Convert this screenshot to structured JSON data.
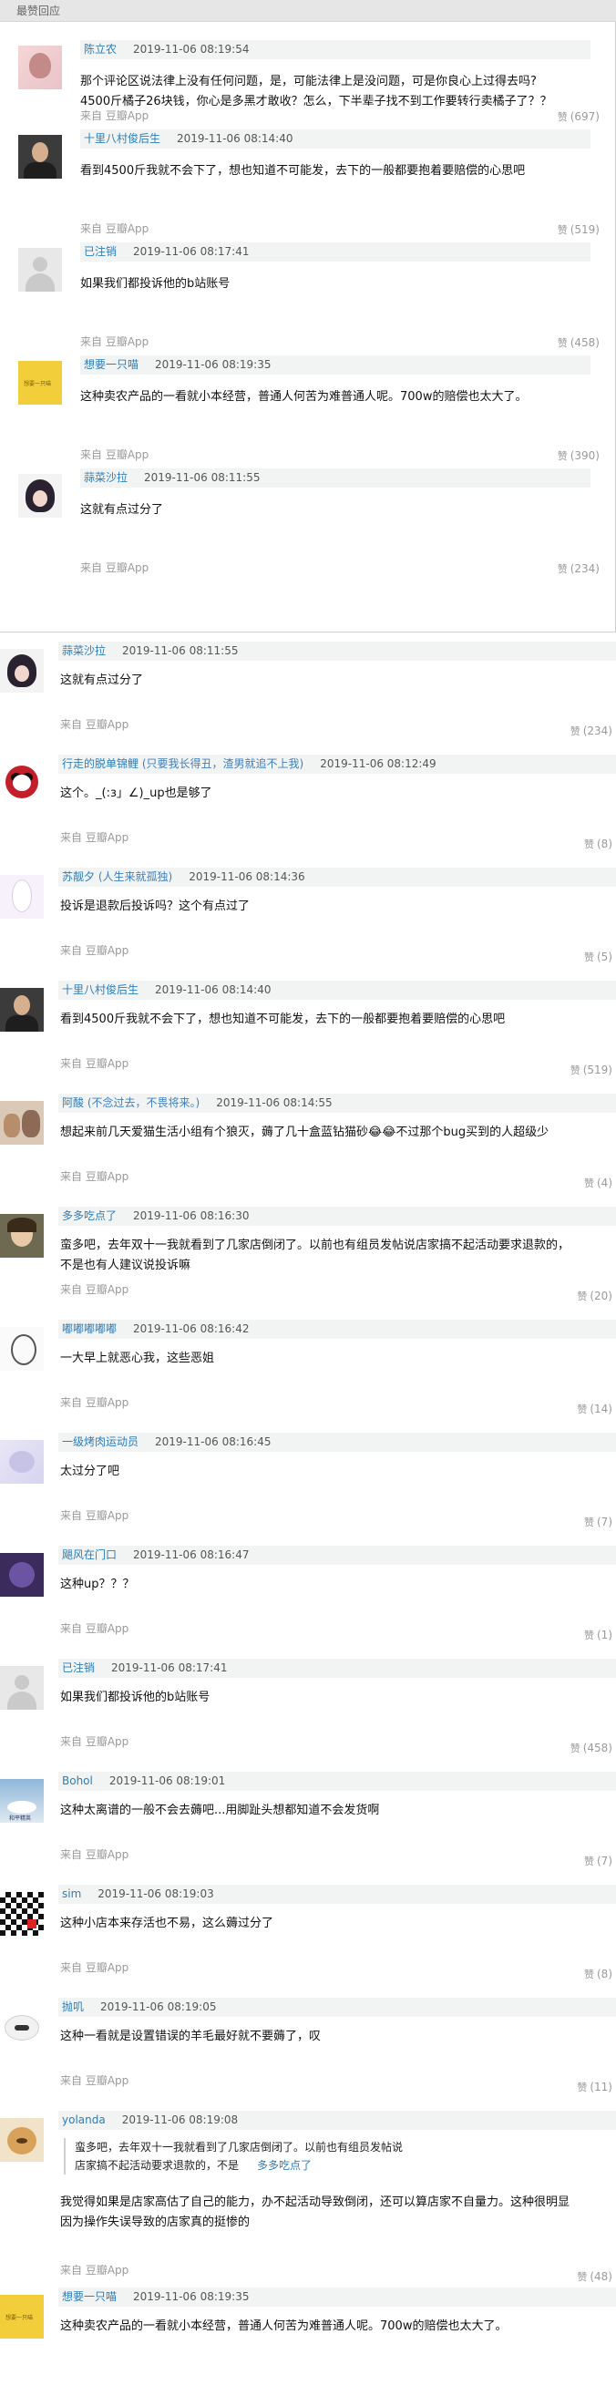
{
  "header": {
    "title": "最赞回应"
  },
  "hot_comments": [
    {
      "author": "陈立农",
      "time": "2019-11-06 08:19:54",
      "text": "那个评论区说法律上没有任何问题，是，可能法律上是没问题，可是你良心上过得去吗?\n4500斤橘子26块钱，你心是多黑才敢收？怎么，下半辈子找不到工作要转行卖橘子了？？",
      "source": "",
      "likes": "",
      "avatar": "pink"
    },
    {
      "author": "十里八村俊后生",
      "time": "2019-11-06 08:14:40",
      "text": "看到4500斤我就不会下了，想也知道不可能发，去下的一般都要抱着要赔偿的心思吧",
      "source": "来自 豆瓣App",
      "likes": "(697)",
      "avatar": "man"
    },
    {
      "author": "已注销",
      "time": "2019-11-06 08:17:41",
      "text": "如果我们都投诉他的b站账号",
      "source": "来自 豆瓣App",
      "likes": "(519)",
      "avatar": "grey"
    },
    {
      "author": "想要一只喵",
      "time": "2019-11-06 08:19:35",
      "text": "这种卖农产品的一看就小本经营，普通人何苦为难普通人呢。700w的赔偿也太大了。",
      "source": "来自 豆瓣App",
      "likes": "(458)",
      "avatar": "yellow"
    },
    {
      "author": "蒜菜沙拉",
      "time": "2019-11-06 08:11:55",
      "text": "这就有点过分了",
      "source": "来自 豆瓣App",
      "likes": "(390)",
      "avatar": "anime"
    },
    {
      "author": "",
      "time": "",
      "text": "",
      "source": "来自 豆瓣App",
      "likes": "(234)",
      "avatar": ""
    }
  ],
  "thread_comments": [
    {
      "author": "蒜菜沙拉",
      "extra": "",
      "time": "2019-11-06 08:11:55",
      "text": "这就有点过分了",
      "likes": "(234)",
      "avatar": "anime"
    },
    {
      "author": "行走的脱单锦鲤",
      "extra": "(只要我长得丑，渣男就追不上我)",
      "time": "2019-11-06 08:12:49",
      "text": "这个。_(:з」∠)_up也是够了",
      "likes": "(8)",
      "avatar": "panda"
    },
    {
      "author": "苏靓夕",
      "extra": "(人生来就孤独)",
      "time": "2019-11-06 08:14:36",
      "text": "投诉是退款后投诉吗？这个有点过了",
      "likes": "(5)",
      "avatar": "rabbit"
    },
    {
      "author": "十里八村俊后生",
      "extra": "",
      "time": "2019-11-06 08:14:40",
      "text": "看到4500斤我就不会下了，想也知道不可能发，去下的一般都要抱着要赔偿的心思吧",
      "likes": "(519)",
      "avatar": "man"
    },
    {
      "author": "阿酸",
      "extra": "(不念过去，不畏将来。)",
      "time": "2019-11-06 08:14:55",
      "text": "想起来前几天爱猫生活小组有个狼灭，薅了几十盒蓝钻猫砂😂😂不过那个bug买到的人超级少",
      "likes": "(4)",
      "avatar": "people"
    },
    {
      "author": "多多吃点了",
      "extra": "",
      "time": "2019-11-06 08:16:30",
      "text": "蛮多吧，去年双十一我就看到了几家店倒闭了。以前也有组员发帖说店家搞不起活动要求退款的，\n不是也有人建议说投诉嘛",
      "likes": "(20)",
      "avatar": "girl"
    },
    {
      "author": "嘟嘟嘟嘟嘟",
      "extra": "",
      "time": "2019-11-06 08:16:42",
      "text": "一大早上就恶心我，这些恶姐",
      "likes": "(14)",
      "avatar": "sketch"
    },
    {
      "author": "一级烤肉运动员",
      "extra": "",
      "time": "2019-11-06 08:16:45",
      "text": "太过分了吧",
      "likes": "(7)",
      "avatar": "lilac"
    },
    {
      "author": "飓风在门口",
      "extra": "",
      "time": "2019-11-06 08:16:47",
      "text": "这种up？？？",
      "likes": "(1)",
      "avatar": "night"
    },
    {
      "author": "已注销",
      "extra": "",
      "time": "2019-11-06 08:17:41",
      "text": "如果我们都投诉他的b站账号",
      "likes": "(458)",
      "avatar": "grey"
    },
    {
      "author": "Bohol",
      "extra": "",
      "time": "2019-11-06 08:19:01",
      "text": "这种太离谱的一般不会去薅吧...用脚趾头想都知道不会发货啊",
      "likes": "(7)",
      "avatar": "sky"
    },
    {
      "author": "sim",
      "extra": "",
      "time": "2019-11-06 08:19:03",
      "text": "这种小店本来存活也不易，这么薅过分了",
      "likes": "(8)",
      "avatar": "checker"
    },
    {
      "author": "抛叽",
      "extra": "",
      "time": "2019-11-06 08:19:05",
      "text": "这种一看就是设置错误的羊毛最好就不要薅了，叹",
      "likes": "(11)",
      "avatar": "cloud"
    },
    {
      "author": "yolanda",
      "extra": "",
      "time": "2019-11-06 08:19:08",
      "quote": "蛮多吧，去年双十一我就看到了几家店倒闭了。以前也有组员发帖说\n店家搞不起活动要求退款的，不是",
      "quote_author": "多多吃点了",
      "text": "我觉得如果是店家高估了自己的能力，办不起活动导致倒闭，还可以算店家不自量力。这种很明显\n因为操作失误导致的店家真的挺惨的",
      "likes": "(48)",
      "avatar": "cat"
    },
    {
      "author": "想要一只喵",
      "extra": "",
      "time": "2019-11-06 08:19:35",
      "text": "这种卖农产品的一看就小本经营，普通人何苦为难普通人呢。700w的赔偿也太大了。",
      "likes": "",
      "avatar": "yellow"
    }
  ],
  "labels": {
    "source": "来自 豆瓣App",
    "like_word": "赞",
    "yellow_avatar_text": "想要一只喵",
    "sky_avatar_text": "和平精英"
  },
  "colors": {
    "link": "#2e7db8",
    "meta_bg": "#f1f4f3",
    "muted": "#9a9a9a"
  }
}
